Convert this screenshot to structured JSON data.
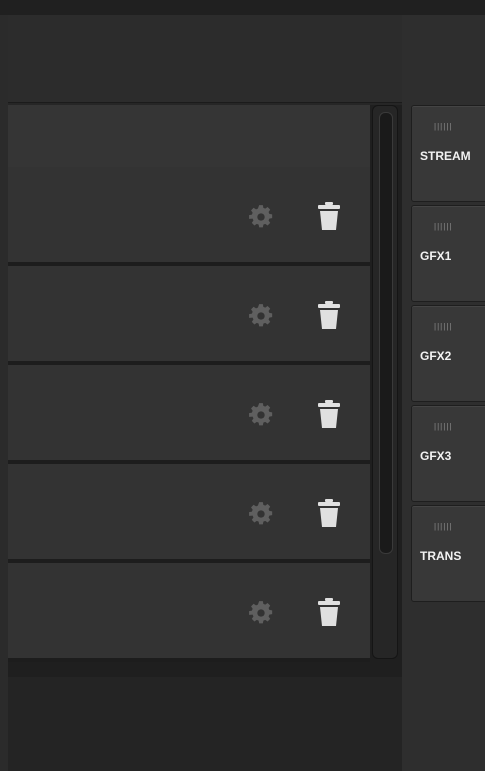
{
  "sidebar": {
    "buttons": [
      {
        "label": "STREAM",
        "grip": "||||||"
      },
      {
        "label": "GFX1",
        "grip": "||||||"
      },
      {
        "label": "GFX2",
        "grip": "||||||"
      },
      {
        "label": "GFX3",
        "grip": "||||||"
      },
      {
        "label": "TRANS",
        "grip": "||||||"
      }
    ]
  },
  "list": {
    "rows": [
      {
        "settings_icon": "gear-icon",
        "delete_icon": "trash-icon"
      },
      {
        "settings_icon": "gear-icon",
        "delete_icon": "trash-icon"
      },
      {
        "settings_icon": "gear-icon",
        "delete_icon": "trash-icon"
      },
      {
        "settings_icon": "gear-icon",
        "delete_icon": "trash-icon"
      },
      {
        "settings_icon": "gear-icon",
        "delete_icon": "trash-icon"
      }
    ]
  },
  "colors": {
    "background": "#2b2b2b",
    "row": "#333333",
    "icon": "#5f5f5f",
    "trash": "#e0e0e0",
    "sidebar_button": "#383838"
  }
}
